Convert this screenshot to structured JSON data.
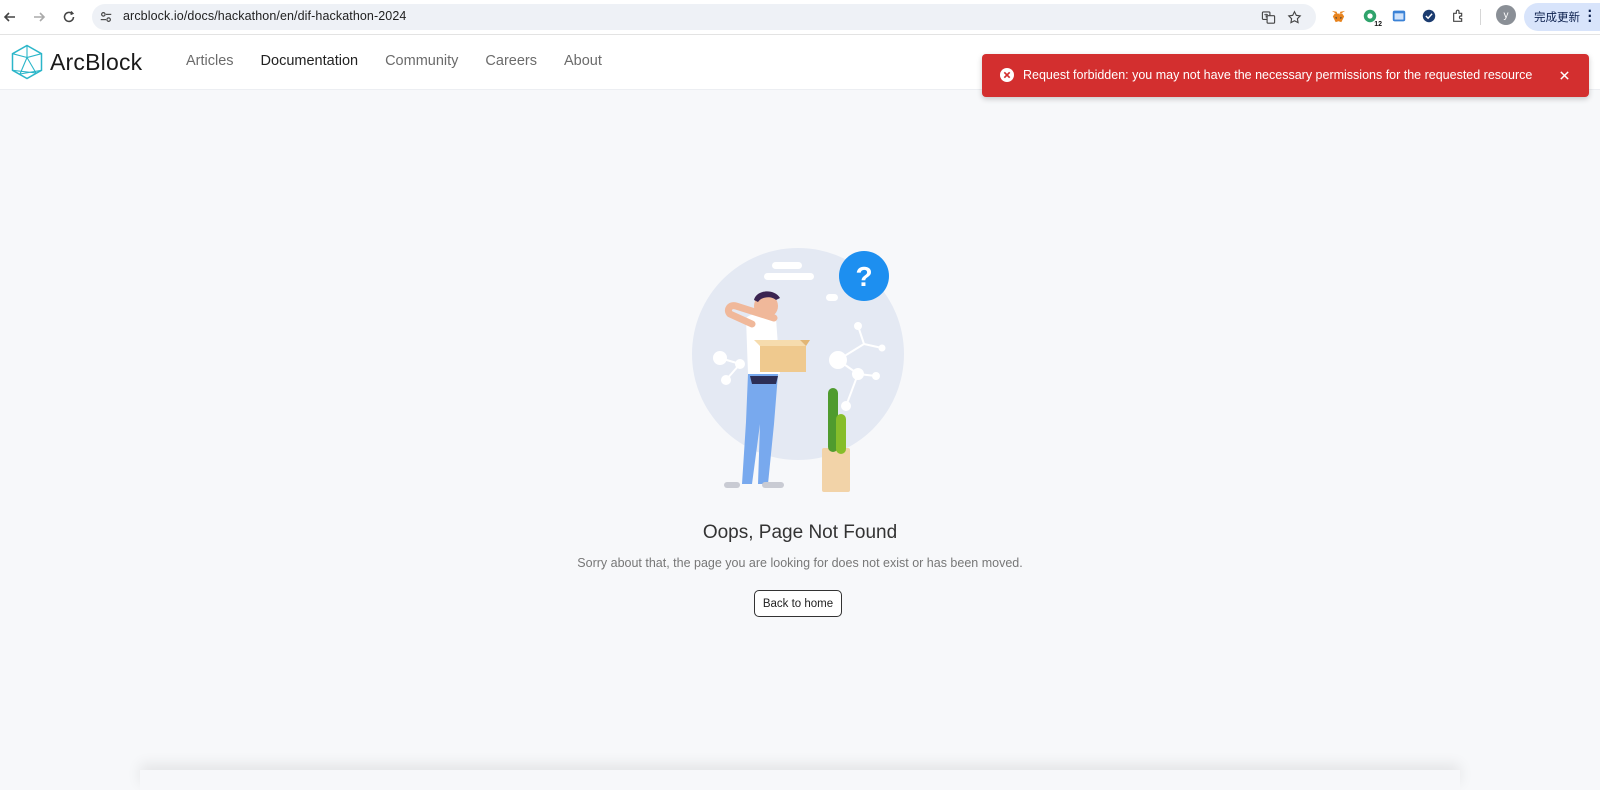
{
  "browser": {
    "url": "arcblock.io/docs/hackathon/en/dif-hackathon-2024",
    "profile_initial": "y",
    "update_label": "完成更新",
    "extension_badge": "12"
  },
  "header": {
    "logo_text": "ArcBlock",
    "nav": [
      {
        "label": "Articles"
      },
      {
        "label": "Documentation"
      },
      {
        "label": "Community"
      },
      {
        "label": "Careers"
      },
      {
        "label": "About"
      }
    ]
  },
  "toast": {
    "message": "Request forbidden: you may not have the necessary permissions for the requested resource",
    "color": "#d32f2f"
  },
  "error_page": {
    "title": "Oops, Page Not Found",
    "subtitle": "Sorry about that, the page you are looking for does not exist or has been moved.",
    "button_label": "Back to home",
    "question_mark": "?"
  },
  "colors": {
    "accent_blue": "#1d8ff0",
    "logo_teal": "#2bb6c9"
  }
}
